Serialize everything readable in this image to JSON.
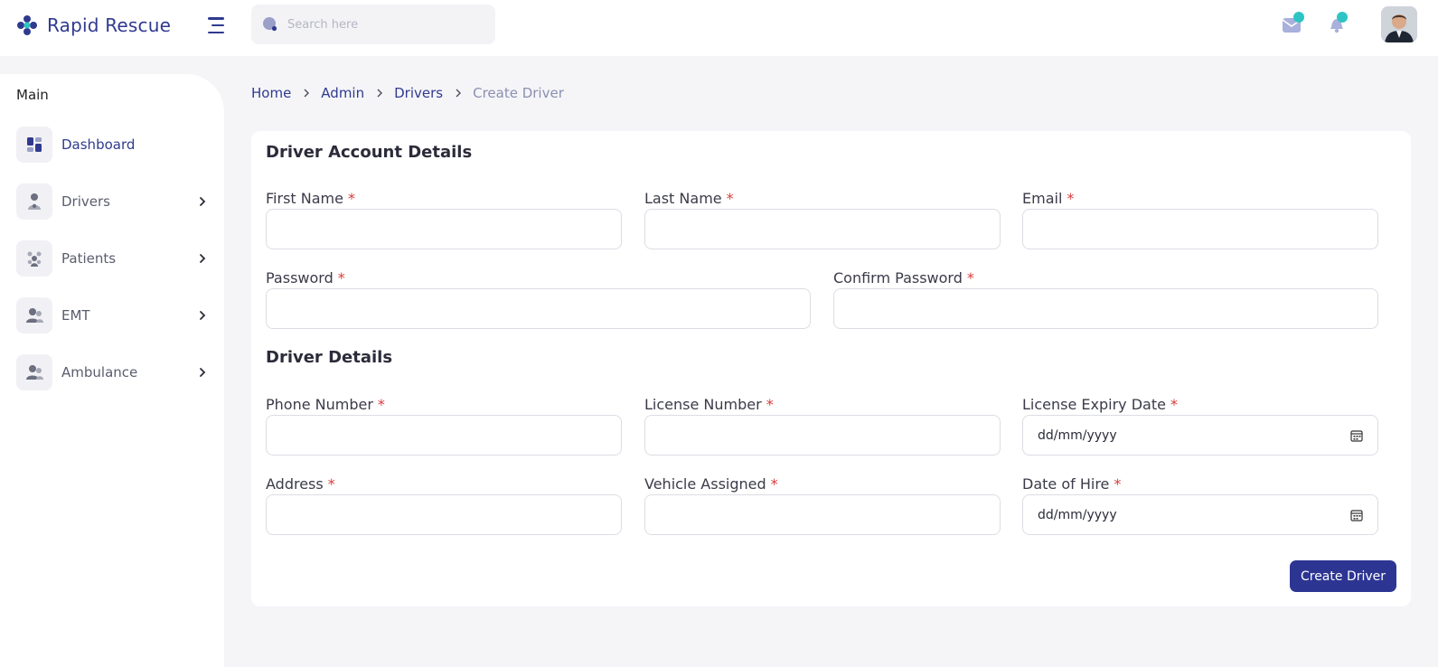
{
  "app": {
    "name": "Rapid Rescue"
  },
  "search": {
    "placeholder": "Search here"
  },
  "sidebar": {
    "heading": "Main",
    "items": [
      {
        "label": "Dashboard",
        "icon": "dashboard-icon",
        "active": true
      },
      {
        "label": "Drivers",
        "icon": "driver-icon"
      },
      {
        "label": "Patients",
        "icon": "patients-icon"
      },
      {
        "label": "EMT",
        "icon": "emt-icon"
      },
      {
        "label": "Ambulance",
        "icon": "ambulance-icon"
      }
    ]
  },
  "breadcrumb": [
    "Home",
    "Admin",
    "Drivers",
    "Create Driver"
  ],
  "form": {
    "section1": "Driver Account Details",
    "section2": "Driver Details",
    "required_mark": "*",
    "fields": {
      "first_name": {
        "label": "First Name",
        "value": ""
      },
      "last_name": {
        "label": "Last Name",
        "value": ""
      },
      "email": {
        "label": "Email",
        "value": ""
      },
      "password": {
        "label": "Password",
        "value": ""
      },
      "confirm_password": {
        "label": "Confirm Password",
        "value": ""
      },
      "phone": {
        "label": "Phone Number",
        "value": ""
      },
      "license_number": {
        "label": "License Number",
        "value": ""
      },
      "license_expiry": {
        "label": "License Expiry Date",
        "value": "dd/mm/yyyy"
      },
      "address": {
        "label": "Address",
        "value": ""
      },
      "vehicle": {
        "label": "Vehicle Assigned",
        "value": ""
      },
      "date_of_hire": {
        "label": "Date of Hire",
        "value": "dd/mm/yyyy"
      }
    },
    "submit_label": "Create Driver"
  },
  "colors": {
    "primary": "#2d3593",
    "accent_teal": "#2ec4c4",
    "required": "#d93a3a",
    "background": "#f5f5f8"
  }
}
